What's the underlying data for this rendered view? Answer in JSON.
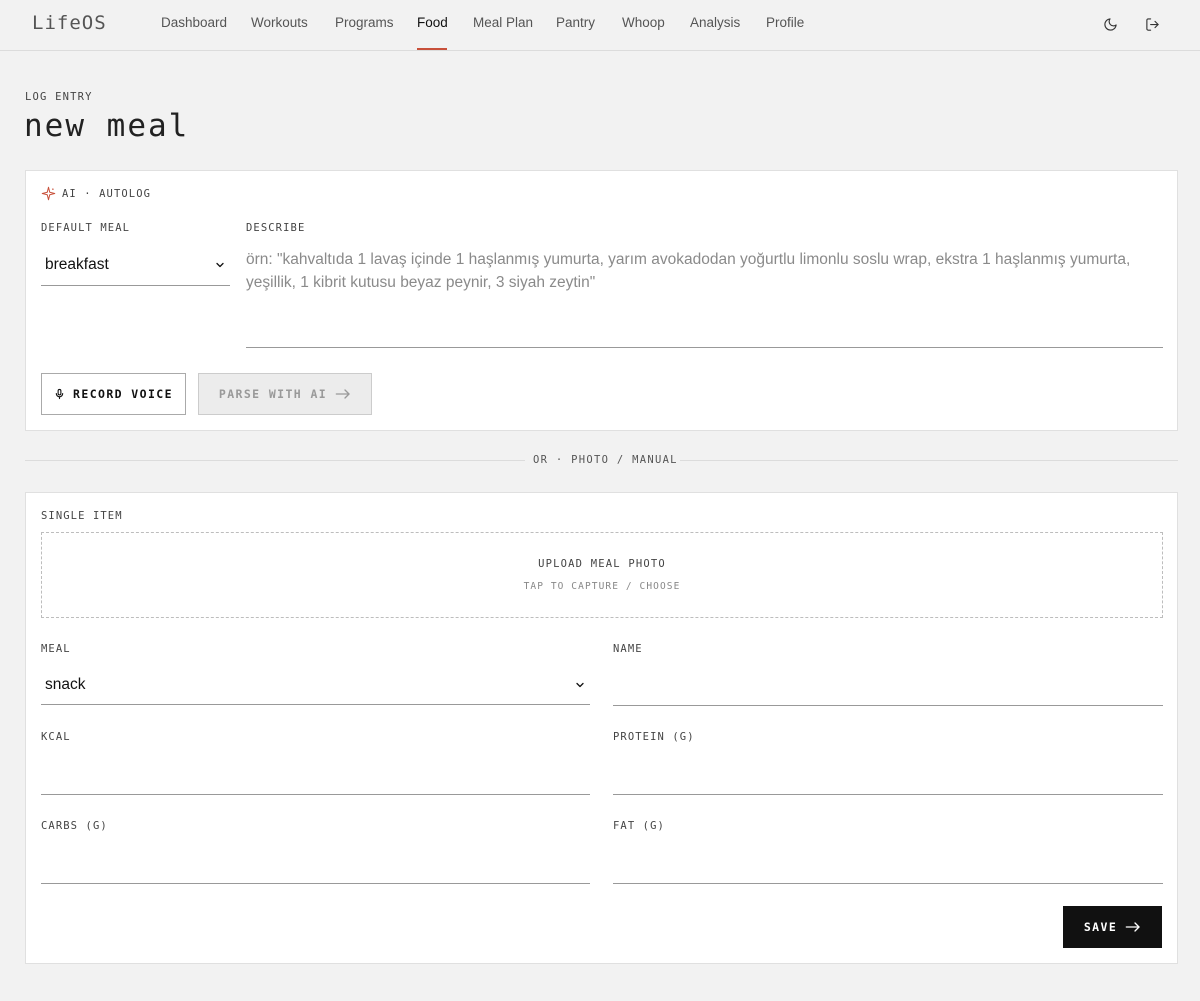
{
  "app": {
    "logo": "LifeOS"
  },
  "nav": {
    "items": [
      {
        "label": "Dashboard"
      },
      {
        "label": "Workouts"
      },
      {
        "label": "Programs"
      },
      {
        "label": "Food"
      },
      {
        "label": "Meal Plan"
      },
      {
        "label": "Pantry"
      },
      {
        "label": "Whoop"
      },
      {
        "label": "Analysis"
      },
      {
        "label": "Profile"
      }
    ],
    "active": "Food",
    "icons": [
      "moon-icon",
      "logout-icon"
    ]
  },
  "header": {
    "eyebrow": "LOG ENTRY",
    "title": "new meal"
  },
  "ai_card": {
    "heading": "AI · AUTOLOG",
    "icon": "sparkle-icon",
    "default_meal_label": "DEFAULT MEAL",
    "default_meal_value": "breakfast",
    "describe_label": "DESCRIBE",
    "describe_placeholder": "örn: \"kahvaltıda 1 lavaş içinde 1 haşlanmış yumurta, yarım avokadodan yoğurtlu limonlu soslu wrap, ekstra 1 haşlanmış yumurta, yeşillik, 1 kibrit kutusu beyaz peynir, 3 siyah zeytin\"",
    "record_button": "RECORD VOICE",
    "parse_button": "PARSE WITH AI"
  },
  "divider": {
    "text": "OR · PHOTO / MANUAL"
  },
  "manual_card": {
    "heading": "SINGLE ITEM",
    "upload_title": "UPLOAD MEAL PHOTO",
    "upload_hint": "TAP TO CAPTURE / CHOOSE",
    "meal_label": "MEAL",
    "meal_value": "snack",
    "name_label": "NAME",
    "kcal_label": "KCAL",
    "protein_label": "PROTEIN (G)",
    "carbs_label": "CARBS (G)",
    "fat_label": "FAT (G)",
    "save_button": "SAVE"
  },
  "colors": {
    "accent": "#c8503a",
    "primary": "#111111",
    "background": "#f2f2f2"
  }
}
